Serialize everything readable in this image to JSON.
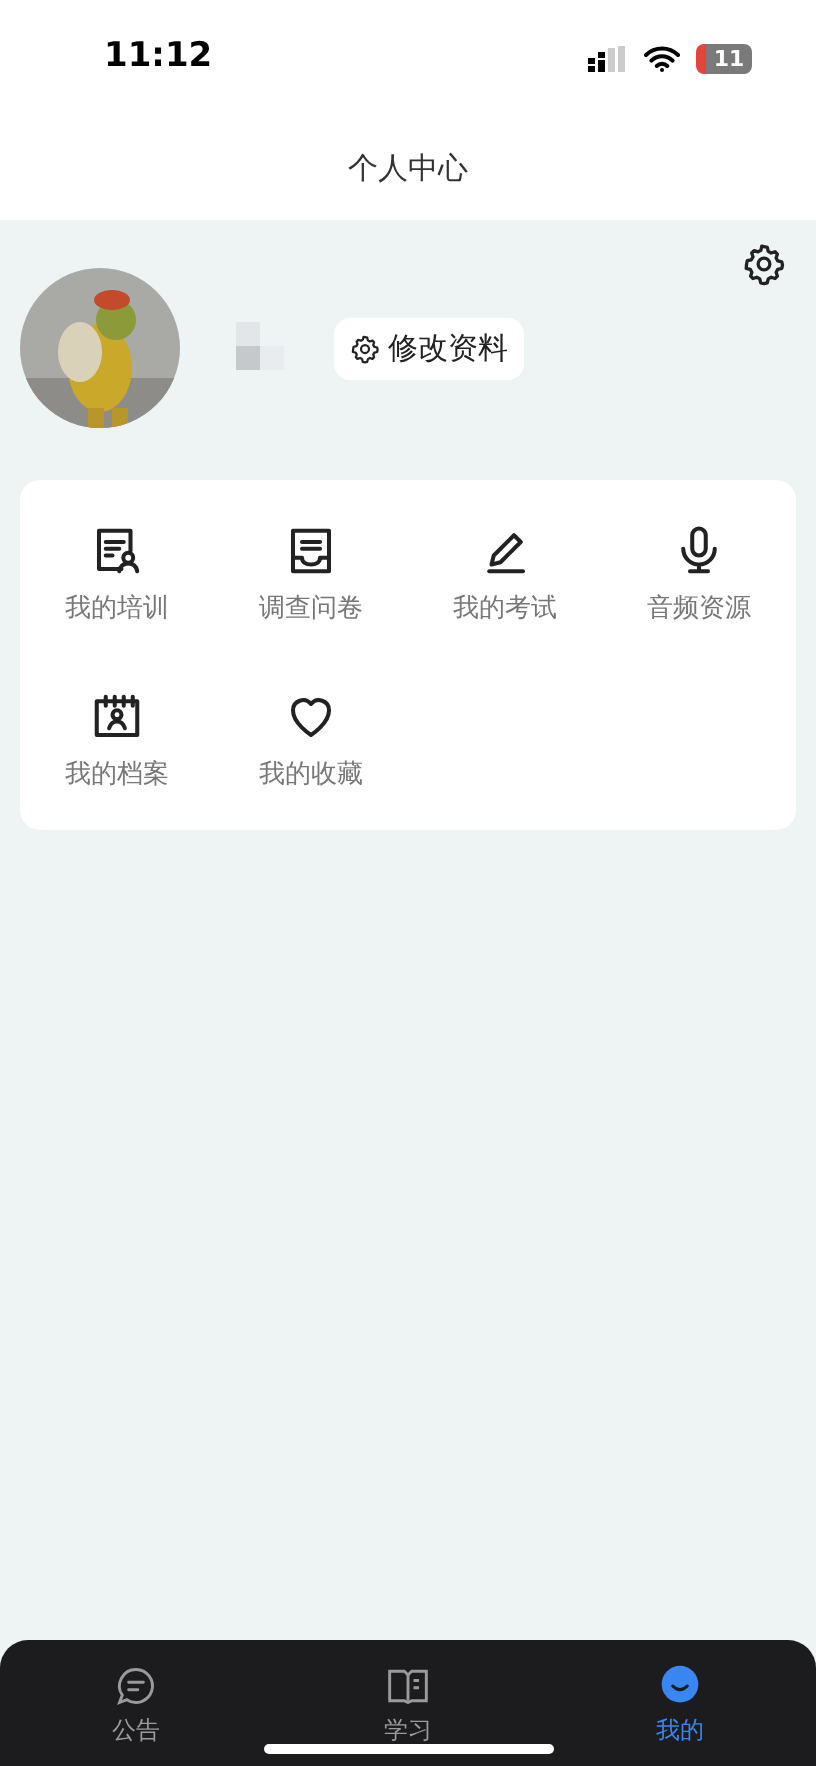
{
  "status_bar": {
    "time": "11:12",
    "battery": "11",
    "battery_low": true
  },
  "header": {
    "title": "个人中心"
  },
  "profile": {
    "name_hidden": true,
    "edit_button": "修改资料"
  },
  "menu": [
    {
      "label": "我的培训"
    },
    {
      "label": "调查问卷"
    },
    {
      "label": "我的考试"
    },
    {
      "label": "音频资源"
    },
    {
      "label": "我的档案"
    },
    {
      "label": "我的收藏"
    }
  ],
  "tab_bar": [
    {
      "label": "公告",
      "selected": false
    },
    {
      "label": "学习",
      "selected": false
    },
    {
      "label": "我的",
      "selected": true
    }
  ]
}
